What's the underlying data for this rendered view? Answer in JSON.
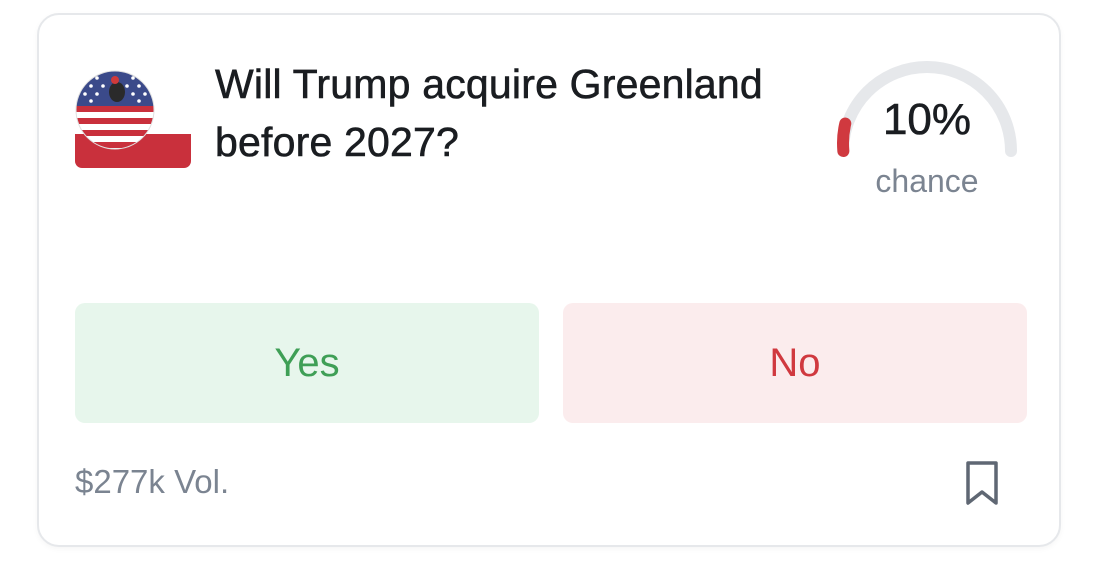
{
  "market": {
    "title": "Will Trump acquire Greenland before 2027?",
    "icon": "usa-greenland-flag-icon",
    "chance": {
      "value": 10,
      "display": "10%",
      "label": "chance",
      "color": "#d0393f"
    },
    "yes_label": "Yes",
    "no_label": "No",
    "volume": "$277k Vol."
  },
  "colors": {
    "yes_bg": "#e7f6ec",
    "yes_text": "#3f9f56",
    "no_bg": "#fbeced",
    "no_text": "#d0393f",
    "muted_text": "#7b8491"
  }
}
